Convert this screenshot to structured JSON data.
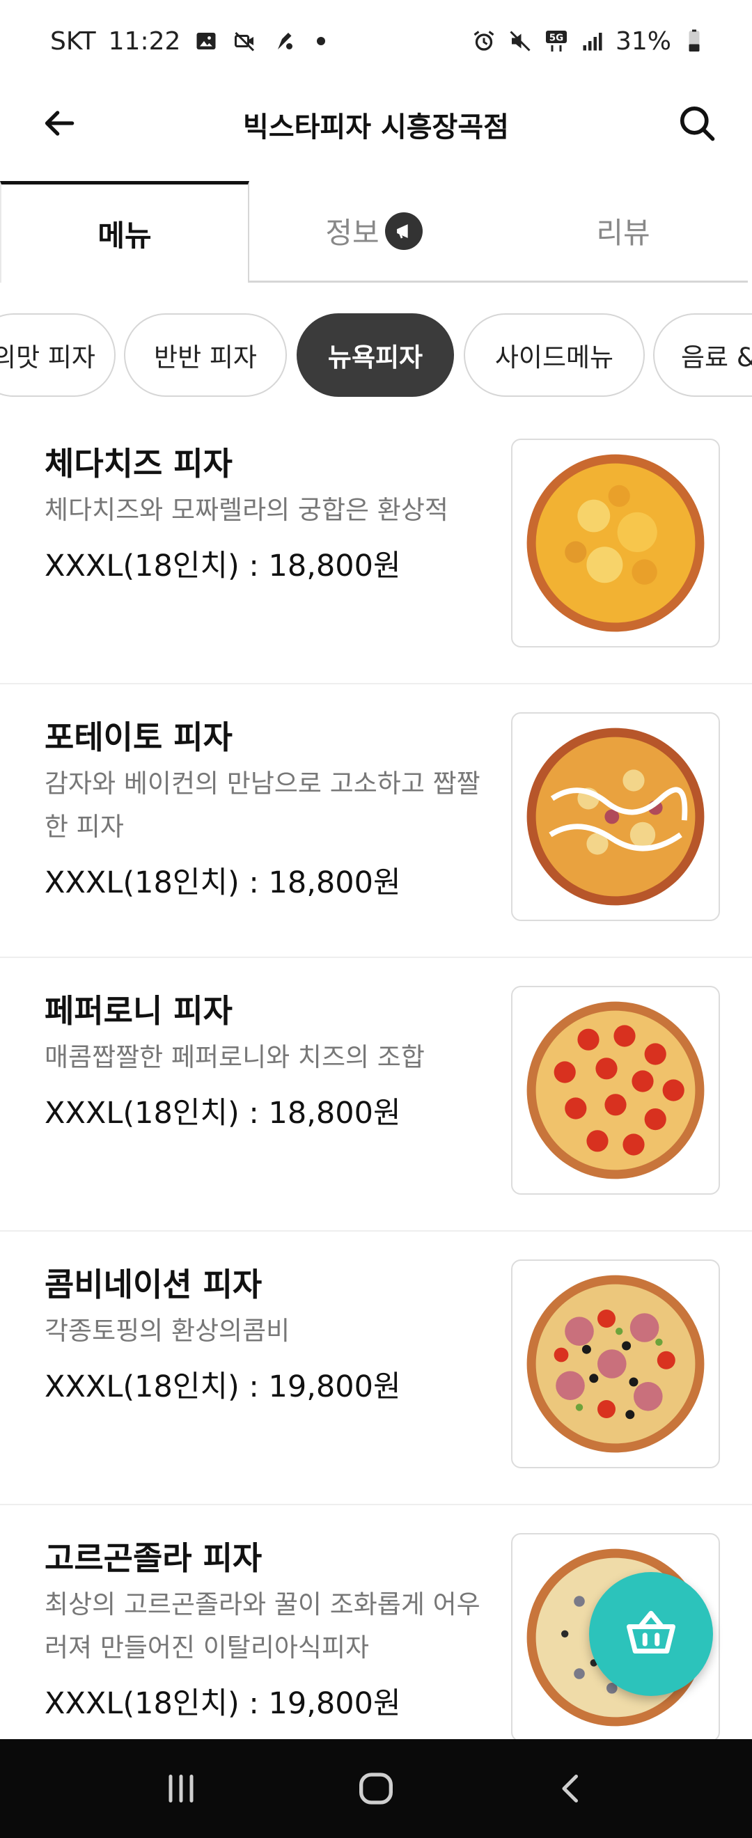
{
  "status_bar": {
    "carrier": "SKT",
    "time": "11:22",
    "battery": "31%",
    "network": "5G"
  },
  "app_bar": {
    "title": "빅스타피자 시흥장곡점"
  },
  "tabs": [
    {
      "label": "메뉴",
      "active": true
    },
    {
      "label": "정보",
      "active": false
    },
    {
      "label": "리뷰",
      "active": false
    }
  ],
  "categories": [
    {
      "label": "의맛 피자",
      "active": false
    },
    {
      "label": "반반 피자",
      "active": false
    },
    {
      "label": "뉴욕피자",
      "active": true
    },
    {
      "label": "사이드메뉴",
      "active": false
    },
    {
      "label": "음료 &",
      "active": false
    }
  ],
  "menu_items": [
    {
      "name": "체다치즈 피자",
      "desc": "체다치즈와 모짜렐라의 궁합은 환상적",
      "price": "XXXL(18인치) : 18,800원",
      "image": "cheddar-pizza"
    },
    {
      "name": "포테이토 피자",
      "desc": "감자와 베이컨의 만남으로 고소하고 짭짤한 피자",
      "price": "XXXL(18인치) : 18,800원",
      "image": "potato-pizza"
    },
    {
      "name": "페퍼로니 피자",
      "desc": "매콤짭짤한 페퍼로니와 치즈의 조합",
      "price": "XXXL(18인치) : 18,800원",
      "image": "pepperoni-pizza"
    },
    {
      "name": "콤비네이션 피자",
      "desc": "각종토핑의 환상의콤비",
      "price": "XXXL(18인치) : 19,800원",
      "image": "combination-pizza"
    },
    {
      "name": "고르곤졸라 피자",
      "desc": "최상의 고르곤졸라와 꿀이 조화롭게 어우러져 만들어진 이탈리아식피자",
      "price": "XXXL(18인치) : 19,800원",
      "image": "gorgonzola-pizza"
    }
  ],
  "colors": {
    "accent": "#2cc3bb",
    "chip_active": "#3b3b3b",
    "nav_bar": "#0a0a0a"
  }
}
